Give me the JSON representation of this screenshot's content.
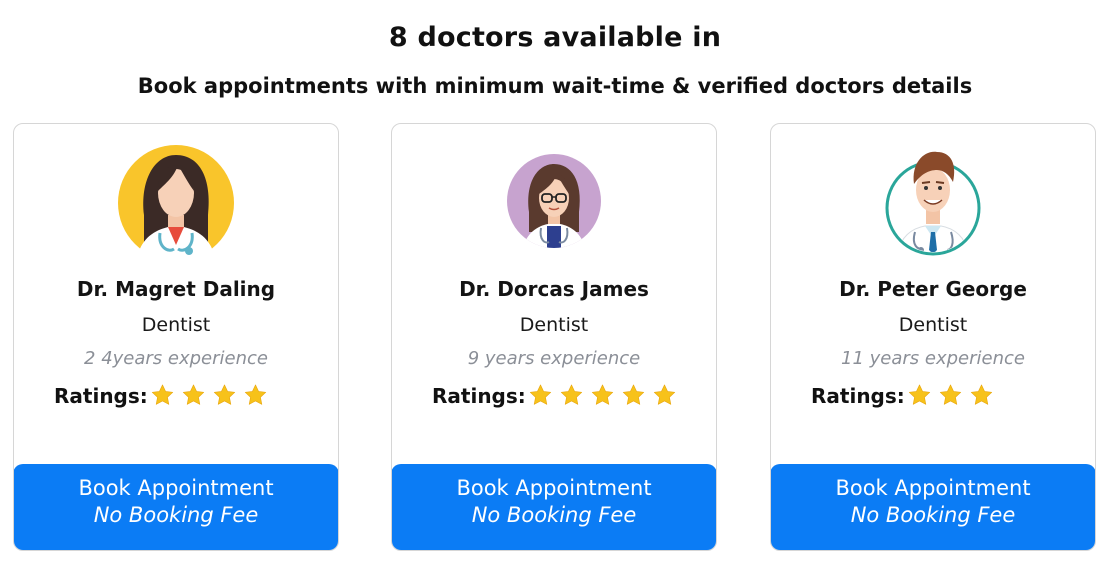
{
  "header": {
    "title": "8 doctors available in",
    "subtitle": "Book appointments with minimum wait-time & verified doctors details"
  },
  "colors": {
    "button": "#0b7cf5",
    "star": "#f7c21a",
    "avatar1_bg": "#f9c52b",
    "avatar2_bg": "#c7a3cf",
    "avatar3_ring": "#2aa69a"
  },
  "doctors": [
    {
      "name": "Dr. Magret Daling",
      "specialty": "Dentist",
      "experience": "2 4years experience",
      "ratings_label": "Ratings:",
      "stars": 4,
      "avatar_icon": "female-doctor-avatar-icon",
      "book_label": "Book Appointment",
      "fee_label": "No Booking Fee"
    },
    {
      "name": "Dr. Dorcas James",
      "specialty": "Dentist",
      "experience": "9 years experience",
      "ratings_label": "Ratings:",
      "stars": 5,
      "avatar_icon": "female-doctor-glasses-avatar-icon",
      "book_label": "Book Appointment",
      "fee_label": "No Booking Fee"
    },
    {
      "name": "Dr. Peter George",
      "specialty": "Dentist",
      "experience": "11 years experience",
      "ratings_label": "Ratings:",
      "stars": 3,
      "avatar_icon": "male-doctor-avatar-icon",
      "book_label": "Book Appointment",
      "fee_label": "No Booking Fee"
    }
  ]
}
